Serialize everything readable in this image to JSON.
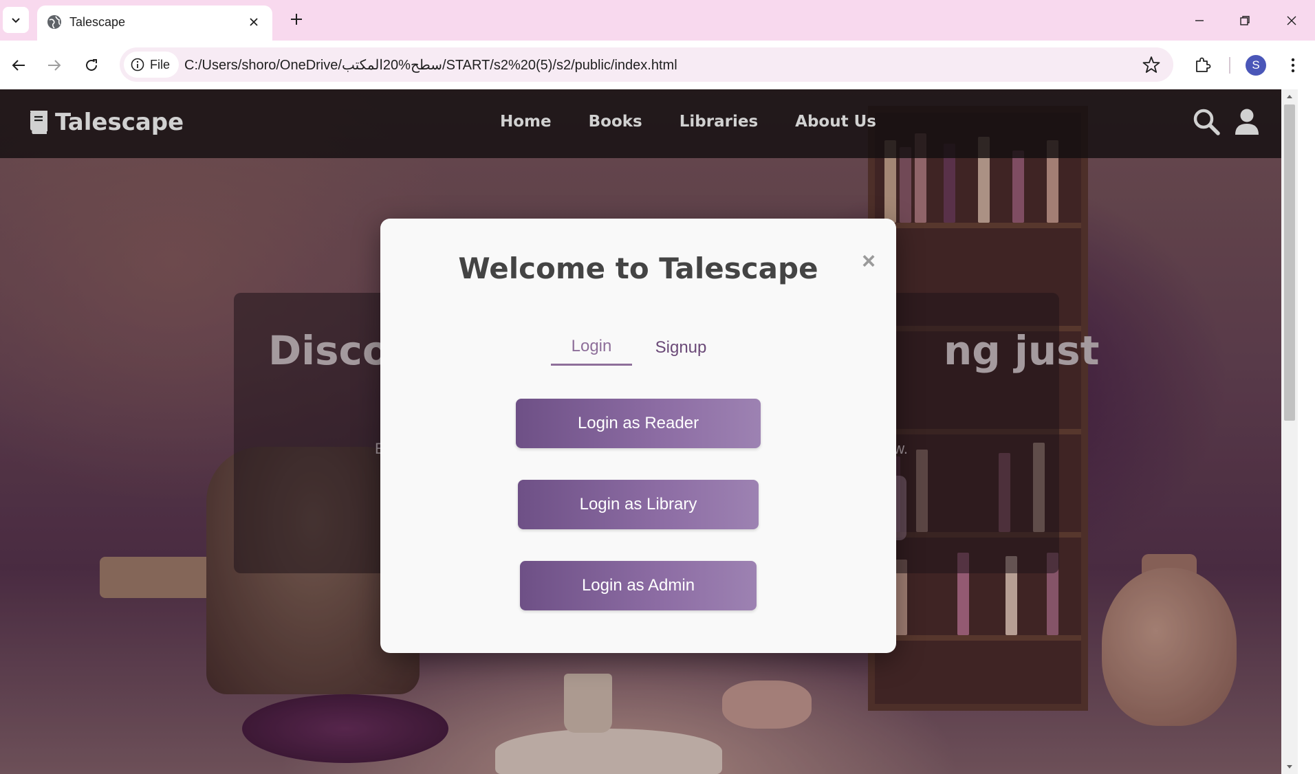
{
  "browser": {
    "tab_title": "Talescape",
    "site_chip_label": "File",
    "url": "C:/Users/shoro/OneDrive/سطح%20المكتب/START/s2%20(5)/s2/public/index.html",
    "profile_initial": "S"
  },
  "site": {
    "brand": "Talescape",
    "nav": [
      "Home",
      "Books",
      "Libraries",
      "About Us"
    ]
  },
  "hero": {
    "title_left": "Disco",
    "title_right": "ng just",
    "subtitle_left": "E",
    "subtitle_right": "ow."
  },
  "modal": {
    "title": "Welcome to Talescape",
    "close": "×",
    "tabs": {
      "login": "Login",
      "signup": "Signup",
      "active": "Login"
    },
    "buttons": {
      "reader": "Login as Reader",
      "library": "Login as Library",
      "admin": "Login as Admin"
    }
  },
  "colors": {
    "accent": "#8e6f9a",
    "button_start": "#6e5086",
    "button_end": "#9d82b2",
    "chrome_bg": "#f8d9ee",
    "navbar_bg": "#181214"
  }
}
